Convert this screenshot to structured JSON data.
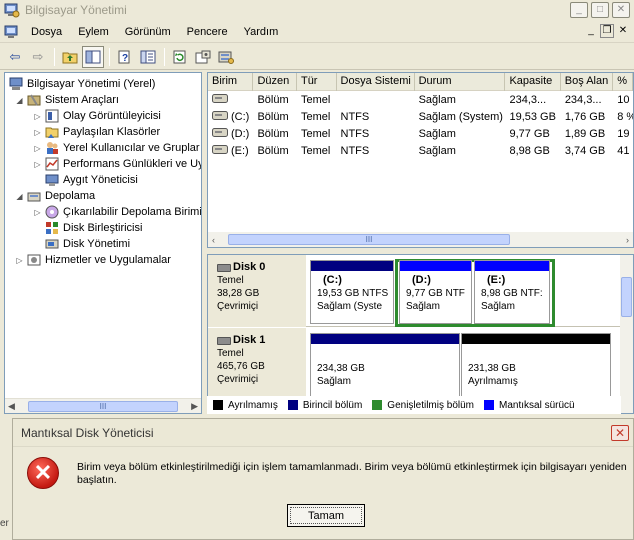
{
  "window": {
    "title": "Bilgisayar Yönetimi",
    "btn_min": "_",
    "btn_max": "□",
    "btn_close": "✕"
  },
  "menu": {
    "items": [
      "Dosya",
      "Eylem",
      "Görünüm",
      "Pencere",
      "Yardım"
    ],
    "inner_min": "_",
    "inner_restore": "❐",
    "inner_close": "✕"
  },
  "toolbar": {
    "back": "⇦",
    "forward": "⇨"
  },
  "tree": {
    "items": [
      {
        "label": "Bilgisayar Yönetimi (Yerel)",
        "expander": ""
      },
      {
        "label": "Sistem Araçları",
        "expander": "◢"
      },
      {
        "label": "Olay Görüntüleyicisi",
        "expander": "▷"
      },
      {
        "label": "Paylaşılan Klasörler",
        "expander": "▷"
      },
      {
        "label": "Yerel Kullanıcılar ve Gruplar",
        "expander": "▷"
      },
      {
        "label": "Performans Günlükleri ve Uy",
        "expander": "▷"
      },
      {
        "label": "Aygıt Yöneticisi",
        "expander": ""
      },
      {
        "label": "Depolama",
        "expander": "◢"
      },
      {
        "label": "Çıkarılabilir Depolama Birimi",
        "expander": "▷"
      },
      {
        "label": "Disk Birleştiricisi",
        "expander": ""
      },
      {
        "label": "Disk Yönetimi",
        "expander": ""
      },
      {
        "label": "Hizmetler ve Uygulamalar",
        "expander": "▷"
      }
    ],
    "scroll_left": "◀",
    "scroll_right": "▶",
    "thumb_grip": "III"
  },
  "volumes": {
    "columns": [
      "Birim",
      "Düzen",
      "Tür",
      "Dosya Sistemi",
      "Durum",
      "Kapasite",
      "Boş Alan",
      "%"
    ],
    "rows": [
      [
        "",
        "Bölüm",
        "Temel",
        "",
        "Sağlam",
        "234,3...",
        "234,3...",
        "10"
      ],
      [
        "(C:)",
        "Bölüm",
        "Temel",
        "NTFS",
        "Sağlam (System)",
        "19,53 GB",
        "1,76 GB",
        "8 %"
      ],
      [
        "(D:)",
        "Bölüm",
        "Temel",
        "NTFS",
        "Sağlam",
        "9,77 GB",
        "1,89 GB",
        "19"
      ],
      [
        "(E:)",
        "Bölüm",
        "Temel",
        "NTFS",
        "Sağlam",
        "8,98 GB",
        "3,74 GB",
        "41"
      ]
    ],
    "scroll_left": "‹",
    "scroll_right": "›",
    "thumb_grip": "III"
  },
  "disks": [
    {
      "name": "Disk 0",
      "type": "Temel",
      "size": "38,28 GB",
      "status": "Çevrimiçi",
      "partitions": [
        {
          "letter": "(C:)",
          "size": "19,53 GB NTFS",
          "status": "Sağlam (Syste"
        },
        {
          "letter": "(D:)",
          "size": "9,77 GB NTF",
          "status": "Sağlam"
        },
        {
          "letter": "(E:)",
          "size": "8,98 GB NTF:",
          "status": "Sağlam"
        }
      ]
    },
    {
      "name": "Disk 1",
      "type": "Temel",
      "size": "465,76 GB",
      "status": "Çevrimiçi",
      "partitions": [
        {
          "letter": "",
          "size": "234,38 GB",
          "status": "Sağlam"
        },
        {
          "letter": "",
          "size": "231,38 GB",
          "status": "Ayrılmamış"
        }
      ]
    }
  ],
  "legend": [
    {
      "label": "Ayrılmamış",
      "color": "#000000"
    },
    {
      "label": "Birincil bölüm",
      "color": "#000080"
    },
    {
      "label": "Genişletilmiş bölüm",
      "color": "#2e8b2e"
    },
    {
      "label": "Mantıksal sürücü",
      "color": "#0000ff"
    }
  ],
  "dialog": {
    "title": "Mantıksal Disk Yöneticisi",
    "close": "✕",
    "icon_glyph": "✕",
    "message": "Birim veya bölüm etkinleştirilmediği için işlem tamamlanmadı. Birim veya bölümü etkinleştirmek için bilgisayarı yeniden başlatın.",
    "ok_label": "Tamam"
  },
  "peek_text": "er"
}
